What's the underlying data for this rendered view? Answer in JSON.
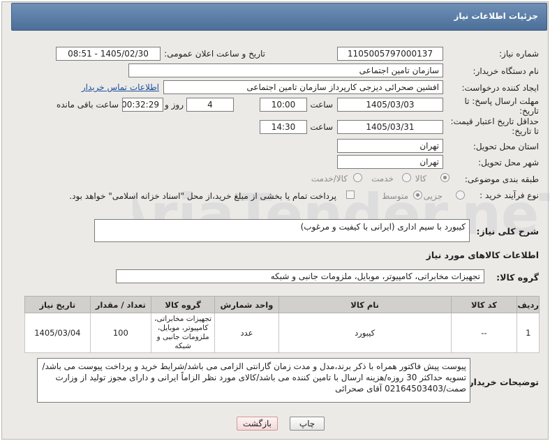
{
  "title": "جزئیات اطلاعات نیاز",
  "fields": {
    "need_number_label": "شماره نیاز:",
    "need_number": "1105005797000137",
    "announce_label": "تاریخ و ساعت اعلان عمومی:",
    "announce_value": "1405/02/30 - 08:51",
    "buyer_org_label": "نام دستگاه خریدار:",
    "buyer_org": "سازمان تامین اجتماعی",
    "requester_label": "ایجاد کننده درخواست:",
    "requester": "افشین صحرائی دیزجی کارپرداز سازمان تامین اجتماعی",
    "contact_link": "اطلاعات تماس خریدار",
    "reply_deadline_label_1": "مهلت ارسال پاسخ: تا",
    "reply_deadline_label_2": "تاریخ:",
    "reply_date": "1405/03/03",
    "time_label": "ساعت",
    "reply_time": "10:00",
    "days_value": "4",
    "days_label": "روز و",
    "remaining_time": "00:32:29",
    "remaining_label": "ساعت باقی مانده",
    "price_validity_label_1": "حداقل تاریخ اعتبار قیمت:",
    "price_validity_label_2": "تا تاریخ:",
    "price_date": "1405/03/31",
    "price_time": "14:30",
    "province_label": "استان محل تحویل:",
    "province": "تهران",
    "city_label": "شهر محل تحویل:",
    "city": "تهران",
    "category_label": "طبقه بندی موضوعی:",
    "category_options": [
      "کالا",
      "خدمت",
      "کالا/خدمت"
    ],
    "category_selected": "کالا",
    "process_label": "نوع فرآیند خرید :",
    "process_options": [
      "جزیی",
      "متوسط"
    ],
    "process_selected": "متوسط",
    "payment_note": "پرداخت تمام یا بخشی از مبلغ خرید،از محل \"اسناد خزانه اسلامی\" خواهد بود."
  },
  "general_desc_label": "شرح کلی نیاز:",
  "general_desc": "کیبورد با سیم اداری (ایرانی با کیفیت و مرغوب)",
  "items_section_title": "اطلاعات کالاهای مورد نیاز",
  "goods_group_label": "گروه کالا:",
  "goods_group": "تجهیزات مخابراتی، کامپیوتر، موبایل، ملزومات جانبی و شبکه",
  "table": {
    "headers": [
      "ردیف",
      "کد کالا",
      "نام کالا",
      "واحد شمارش",
      "گروه کالا",
      "تعداد / مقدار",
      "تاریخ نیاز"
    ],
    "rows": [
      {
        "row": "1",
        "code": "--",
        "name": "کیبورد",
        "unit": "عدد",
        "group": "تجهیزات مخابراتی، کامپیوتر، موبایل، ملزومات جانبی و شبکه",
        "qty": "100",
        "date": "1405/03/04"
      }
    ]
  },
  "buyer_notes_label": "توضیحات خریدار:",
  "buyer_notes": "پیوست پیش فاکتور همراه با ذکر برند،مدل و مدت زمان گارانتی الزامی می باشد/شرایط خرید و پرداخت پیوست می باشد/تسویه حداکثر 30 روزه/هزینه ارسال با تامین کننده می باشد/کالای مورد نظر الزاماً ایرانی و دارای مجوز تولید از وزارت صمت/02164503403 آقای صحرائی",
  "buttons": {
    "print": "چاپ",
    "back": "بازگشت"
  },
  "watermark_text": "AriaTender.neT",
  "colors": {
    "title_bar": "#5a7ca6",
    "link": "#1a4fa0",
    "panel_bg": "#eceae6"
  }
}
